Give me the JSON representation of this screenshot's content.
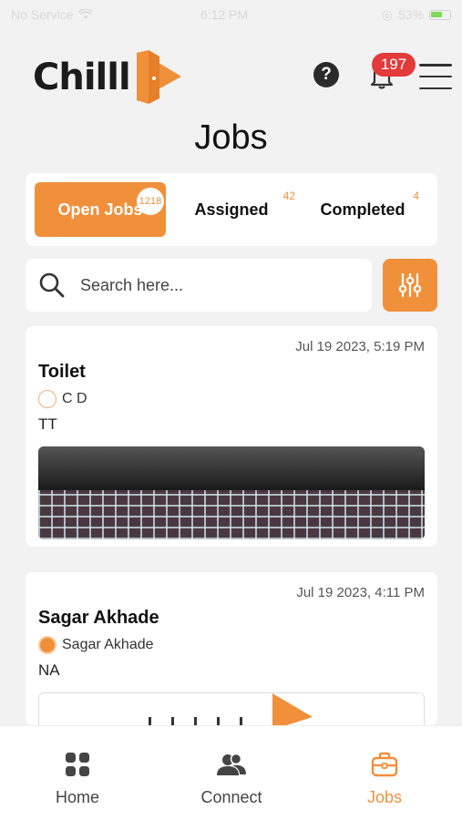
{
  "status_bar": {
    "carrier": "No Service",
    "time": "6:12 PM",
    "battery": "53%"
  },
  "header": {
    "logo_text": "Chilll",
    "notification_count": "197",
    "help_symbol": "?"
  },
  "page": {
    "title": "Jobs"
  },
  "tabs": [
    {
      "label": "Open Jobs",
      "count": "1218",
      "active": true
    },
    {
      "label": "Assigned",
      "count": "42",
      "active": false
    },
    {
      "label": "Completed",
      "count": "4",
      "active": false
    }
  ],
  "search": {
    "placeholder": "Search here..."
  },
  "jobs": [
    {
      "date": "Jul 19 2023, 5:19 PM",
      "title": "Toilet",
      "user": "C D",
      "description": "TT"
    },
    {
      "date": "Jul 19 2023, 4:11 PM",
      "title": "Sagar Akhade",
      "user": "Sagar Akhade",
      "description": "NA"
    }
  ],
  "bottom_nav": [
    {
      "label": "Home",
      "icon": "grid-icon",
      "active": false
    },
    {
      "label": "Connect",
      "icon": "users-icon",
      "active": false
    },
    {
      "label": "Jobs",
      "icon": "briefcase-icon",
      "active": true
    }
  ],
  "colors": {
    "accent": "#f0903b",
    "badge": "#e23b3b",
    "background": "#f2f2f2"
  }
}
